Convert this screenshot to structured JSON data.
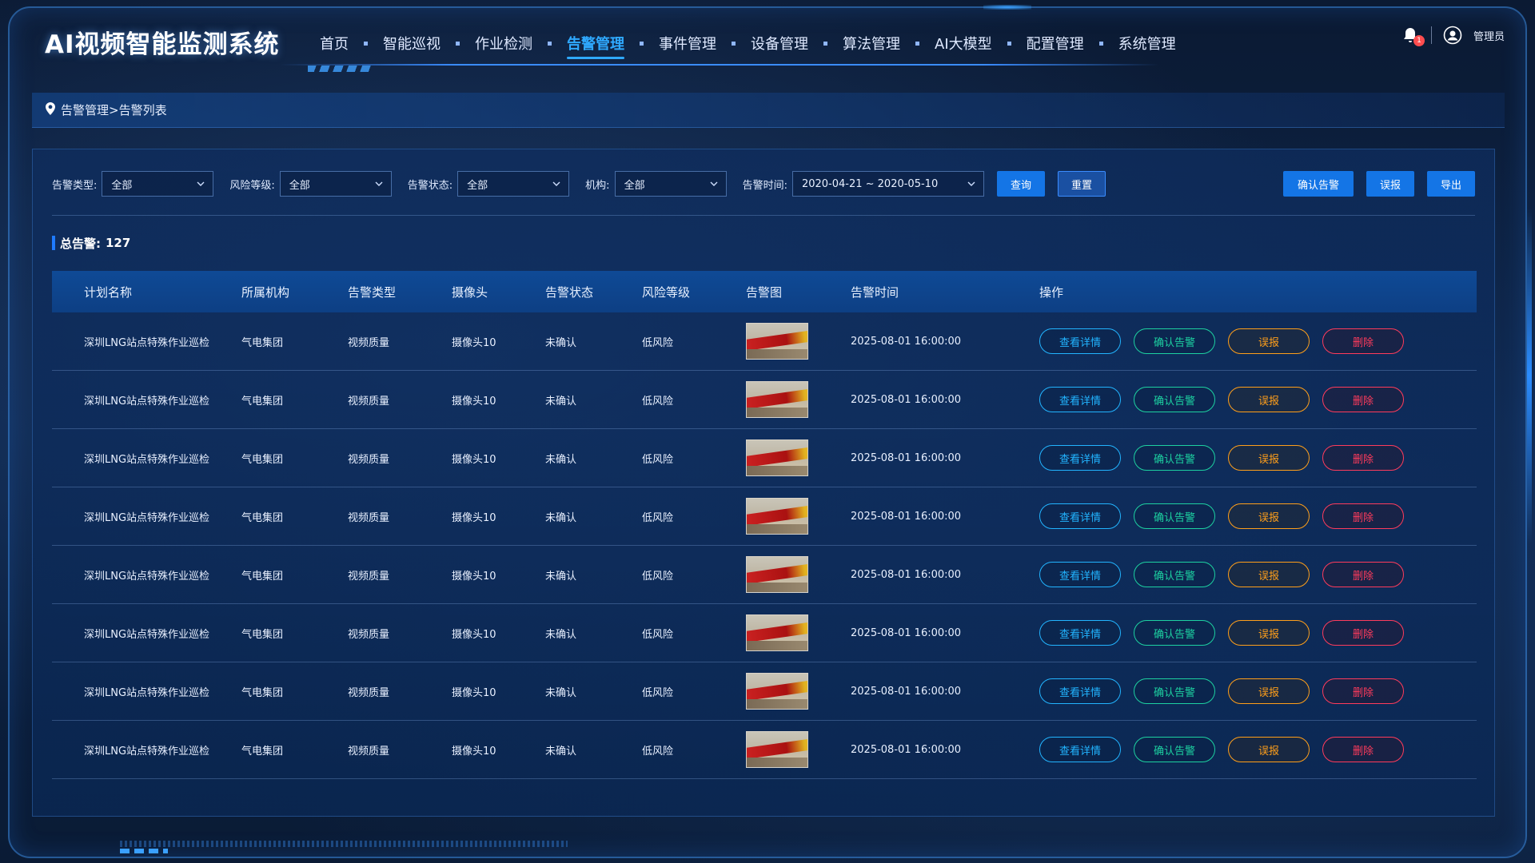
{
  "app": {
    "title": "AI视频智能监测系统"
  },
  "nav": {
    "items": [
      {
        "label": "首页"
      },
      {
        "label": "智能巡视"
      },
      {
        "label": "作业检测"
      },
      {
        "label": "告警管理"
      },
      {
        "label": "事件管理"
      },
      {
        "label": "设备管理"
      },
      {
        "label": "算法管理"
      },
      {
        "label": "AI大模型"
      },
      {
        "label": "配置管理"
      },
      {
        "label": "系统管理"
      }
    ],
    "active_index": 3
  },
  "user": {
    "name": "管理员",
    "notification_count": "1"
  },
  "breadcrumb": {
    "text": "告警管理>告警列表"
  },
  "filters": {
    "alarm_type": {
      "label": "告警类型:",
      "value": "全部"
    },
    "risk_level": {
      "label": "风险等级:",
      "value": "全部"
    },
    "alarm_status": {
      "label": "告警状态:",
      "value": "全部"
    },
    "org": {
      "label": "机构:",
      "value": "全部"
    },
    "alarm_time": {
      "label": "告警时间:",
      "value": "2020-04-21 ~ 2020-05-10"
    },
    "query_label": "查询",
    "reset_label": "重置",
    "confirm_label": "确认告警",
    "false_alarm_label": "误报",
    "export_label": "导出"
  },
  "summary": {
    "label": "总告警:",
    "value": "127"
  },
  "table": {
    "columns": [
      "计划名称",
      "所属机构",
      "告警类型",
      "摄像头",
      "告警状态",
      "风险等级",
      "告警图",
      "告警时间",
      "操作"
    ],
    "actions": {
      "view": "查看详情",
      "confirm": "确认告警",
      "false": "误报",
      "delete": "删除"
    },
    "rows": [
      {
        "plan": "深圳LNG站点特殊作业巡检",
        "org": "气电集团",
        "type": "视频质量",
        "camera": "摄像头10",
        "status": "未确认",
        "risk": "低风险",
        "time": "2025-08-01 16:00:00"
      },
      {
        "plan": "深圳LNG站点特殊作业巡检",
        "org": "气电集团",
        "type": "视频质量",
        "camera": "摄像头10",
        "status": "未确认",
        "risk": "低风险",
        "time": "2025-08-01 16:00:00"
      },
      {
        "plan": "深圳LNG站点特殊作业巡检",
        "org": "气电集团",
        "type": "视频质量",
        "camera": "摄像头10",
        "status": "未确认",
        "risk": "低风险",
        "time": "2025-08-01 16:00:00"
      },
      {
        "plan": "深圳LNG站点特殊作业巡检",
        "org": "气电集团",
        "type": "视频质量",
        "camera": "摄像头10",
        "status": "未确认",
        "risk": "低风险",
        "time": "2025-08-01 16:00:00"
      },
      {
        "plan": "深圳LNG站点特殊作业巡检",
        "org": "气电集团",
        "type": "视频质量",
        "camera": "摄像头10",
        "status": "未确认",
        "risk": "低风险",
        "time": "2025-08-01 16:00:00"
      },
      {
        "plan": "深圳LNG站点特殊作业巡检",
        "org": "气电集团",
        "type": "视频质量",
        "camera": "摄像头10",
        "status": "未确认",
        "risk": "低风险",
        "time": "2025-08-01 16:00:00"
      },
      {
        "plan": "深圳LNG站点特殊作业巡检",
        "org": "气电集团",
        "type": "视频质量",
        "camera": "摄像头10",
        "status": "未确认",
        "risk": "低风险",
        "time": "2025-08-01 16:00:00"
      },
      {
        "plan": "深圳LNG站点特殊作业巡检",
        "org": "气电集团",
        "type": "视频质量",
        "camera": "摄像头10",
        "status": "未确认",
        "risk": "低风险",
        "time": "2025-08-01 16:00:00"
      }
    ]
  },
  "colors": {
    "accent": "#2fa9ff",
    "primary_button": "#1475e6",
    "view": "#22b4ff",
    "confirm": "#1dd1a1",
    "false_alarm": "#ff9f1a",
    "delete": "#ff3b5c"
  },
  "icons": {
    "location": "location-pin-icon",
    "bell": "bell-icon",
    "user": "user-avatar-icon",
    "dropdown": "chevron-down-icon"
  }
}
